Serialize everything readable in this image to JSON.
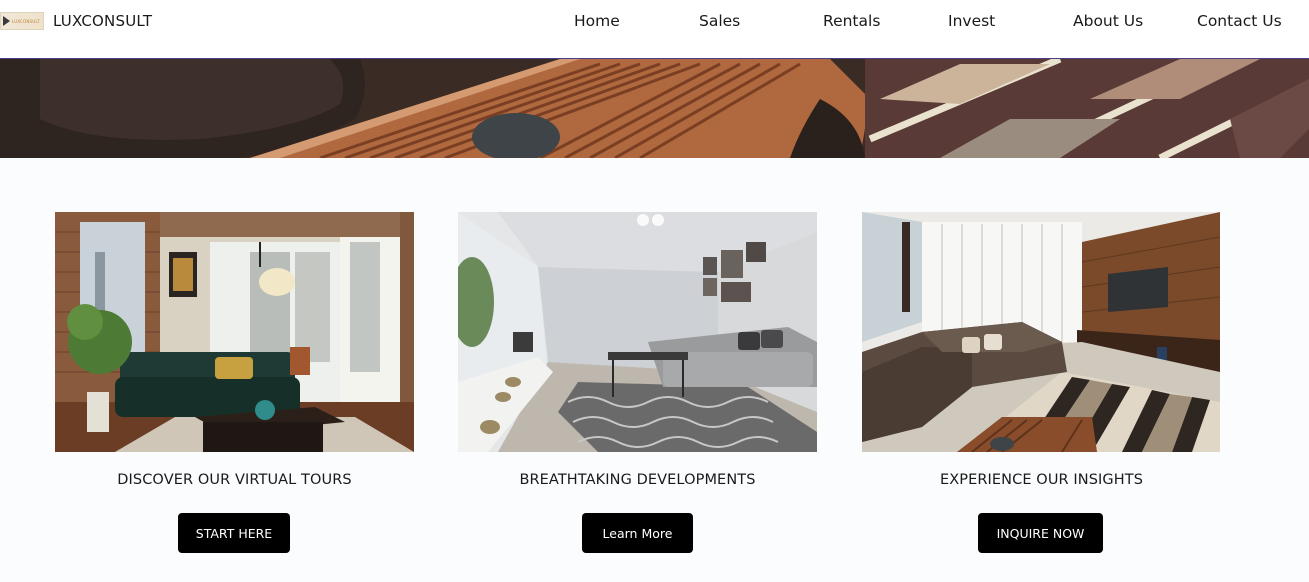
{
  "brand": {
    "name": "LUXCONSULT",
    "logo_text": "LUXCONSULT"
  },
  "nav": {
    "items": [
      {
        "label": "Home"
      },
      {
        "label": "Sales"
      },
      {
        "label": "Rentals"
      },
      {
        "label": "Invest"
      },
      {
        "label": "About Us"
      },
      {
        "label": "Contact Us"
      }
    ]
  },
  "cards": [
    {
      "title": "DISCOVER OUR VIRTUAL TOURS",
      "button": "START HERE"
    },
    {
      "title": "BREATHTAKING DEVELOPMENTS",
      "button": "Learn More"
    },
    {
      "title": "EXPERIENCE OUR INSIGHTS",
      "button": "INQUIRE NOW"
    }
  ],
  "colors": {
    "header_border": "#4b3f8a",
    "button_bg": "#000000",
    "button_text": "#ffffff",
    "page_bg": "#fbfcfd"
  }
}
